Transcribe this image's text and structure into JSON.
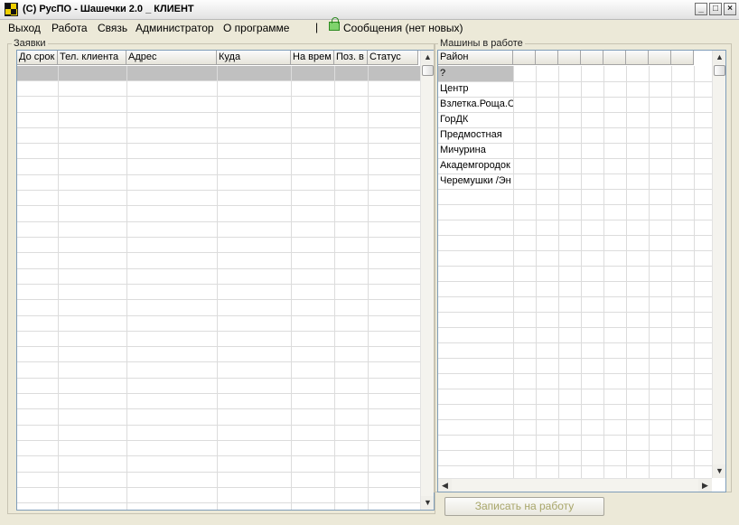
{
  "window": {
    "title": "(C) РусПО - Шашечки 2.0 _ КЛИЕНТ",
    "minimize_glyph": "_",
    "maximize_glyph": "□",
    "close_glyph": "×"
  },
  "menu": {
    "items": [
      "Выход",
      "Работа",
      "Связь",
      "Администратор",
      "О программе"
    ],
    "separator": "|",
    "messages": "Сообщения (нет новых)",
    "messages_icon": "envelope-icon"
  },
  "orders": {
    "label": "Заявки",
    "columns": [
      "До срок",
      "Тел. клиента",
      "Адрес",
      "Куда",
      "На врем",
      "Поз. в",
      "Статус"
    ],
    "selected_row_color": "#c0c0c0"
  },
  "cars": {
    "label": "Машины в работе",
    "region_header": "Район",
    "regions": [
      "?",
      "Центр",
      "Взлетка.Роща.С",
      "ГорДК",
      "Предмостная",
      "Мичурина",
      "Академгородок",
      "Черемушки /Эн"
    ]
  },
  "scroll": {
    "up": "▲",
    "down": "▼",
    "left": "◀",
    "right": "▶"
  },
  "assign_button": "Записать на работу",
  "colors": {
    "window_bg": "#ece9d8",
    "grid_border": "#7f9db9",
    "disabled_text": "#a8a66a"
  }
}
